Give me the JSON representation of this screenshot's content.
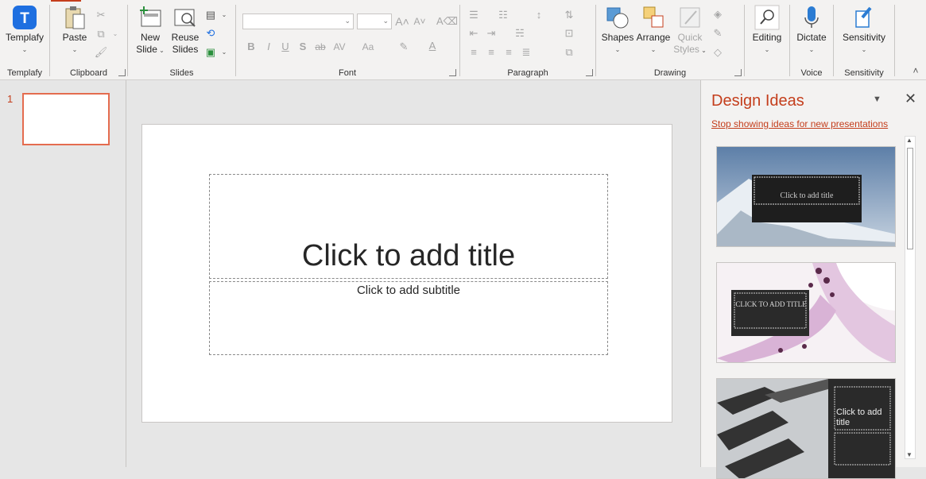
{
  "ribbon": {
    "templafy": {
      "label": "Templafy",
      "group": "Templafy"
    },
    "clipboard": {
      "paste": "Paste",
      "group": "Clipboard"
    },
    "slides": {
      "new_slide_1": "New",
      "new_slide_2": "Slide",
      "reuse_1": "Reuse",
      "reuse_2": "Slides",
      "group": "Slides"
    },
    "font": {
      "group": "Font",
      "bold": "B",
      "italic": "I",
      "underline": "U",
      "shadow": "S",
      "strike": "ab",
      "spacing": "AV",
      "case": "Aa",
      "font_color": "A"
    },
    "paragraph": {
      "group": "Paragraph"
    },
    "drawing": {
      "shapes": "Shapes",
      "arrange": "Arrange",
      "quick_1": "Quick",
      "quick_2": "Styles",
      "group": "Drawing"
    },
    "editing": {
      "label": "Editing"
    },
    "voice": {
      "dictate": "Dictate",
      "group": "Voice"
    },
    "sensitivity": {
      "label": "Sensitivity",
      "group": "Sensitivity"
    }
  },
  "thumbnails": [
    {
      "number": "1"
    }
  ],
  "slide": {
    "title": "Click to add title",
    "subtitle": "Click to add subtitle"
  },
  "design_pane": {
    "title": "Design Ideas",
    "stop_link": "Stop showing ideas for new presentations",
    "ideas": [
      {
        "title": "Click to add title"
      },
      {
        "title": "CLICK TO ADD TITLE"
      },
      {
        "title": "Click to add title"
      }
    ]
  },
  "colors": {
    "accent": "#c43e1c",
    "ribbon": "#f3f2f1",
    "workspace": "#e6e6e6"
  }
}
